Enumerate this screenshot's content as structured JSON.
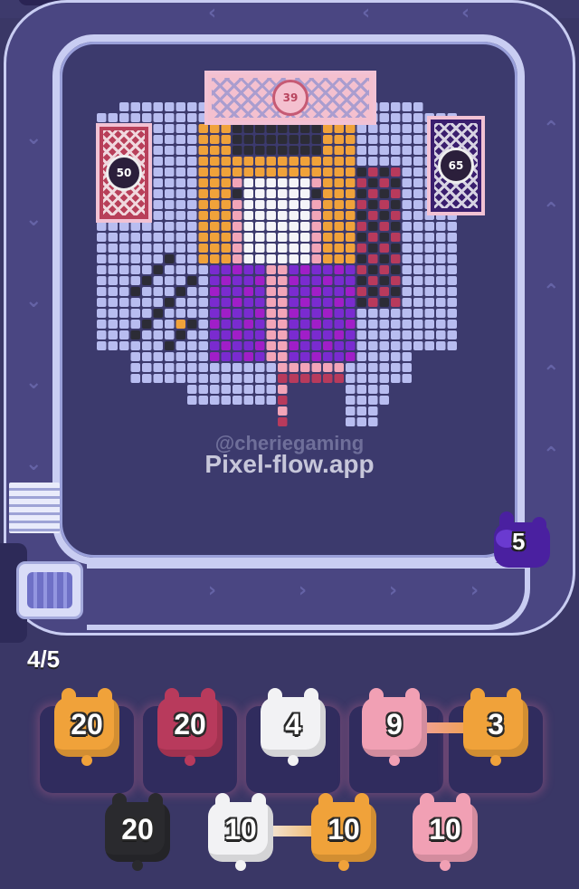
{
  "game": {
    "watermark_handle": "@cheriegaming",
    "watermark_site": "Pixel-flow.app",
    "slots_counter": "4/5"
  },
  "banners": [
    {
      "id": "top",
      "value": "39"
    },
    {
      "id": "left",
      "value": "50"
    },
    {
      "id": "right",
      "value": "65"
    }
  ],
  "conveyor_shooter": {
    "value": "5",
    "color": "#5a2bb0"
  },
  "queue_row1": [
    {
      "value": "20",
      "color": "#f0a23a"
    },
    {
      "value": "20",
      "color": "#b83a5c"
    },
    {
      "value": "4",
      "color": "#f2f2f4"
    },
    {
      "value": "9",
      "color": "#f1a0b4"
    },
    {
      "value": "3",
      "color": "#f0a23a"
    }
  ],
  "queue_row2": [
    {
      "value": "20",
      "color": "#2a2a2e"
    },
    {
      "value": "10",
      "color": "#f2f2f4"
    },
    {
      "value": "10",
      "color": "#f0a23a"
    },
    {
      "value": "10",
      "color": "#f1a0b4"
    }
  ],
  "palette": {
    "lavender": "#b8bdf0",
    "orange": "#f0a23a",
    "pink": "#f2a5b8",
    "white": "#f4f4f8",
    "dark": "#2c2c36",
    "purple": "#7a2bd0",
    "magenta": "#a01ec8",
    "crimson": "#b83a5c"
  }
}
